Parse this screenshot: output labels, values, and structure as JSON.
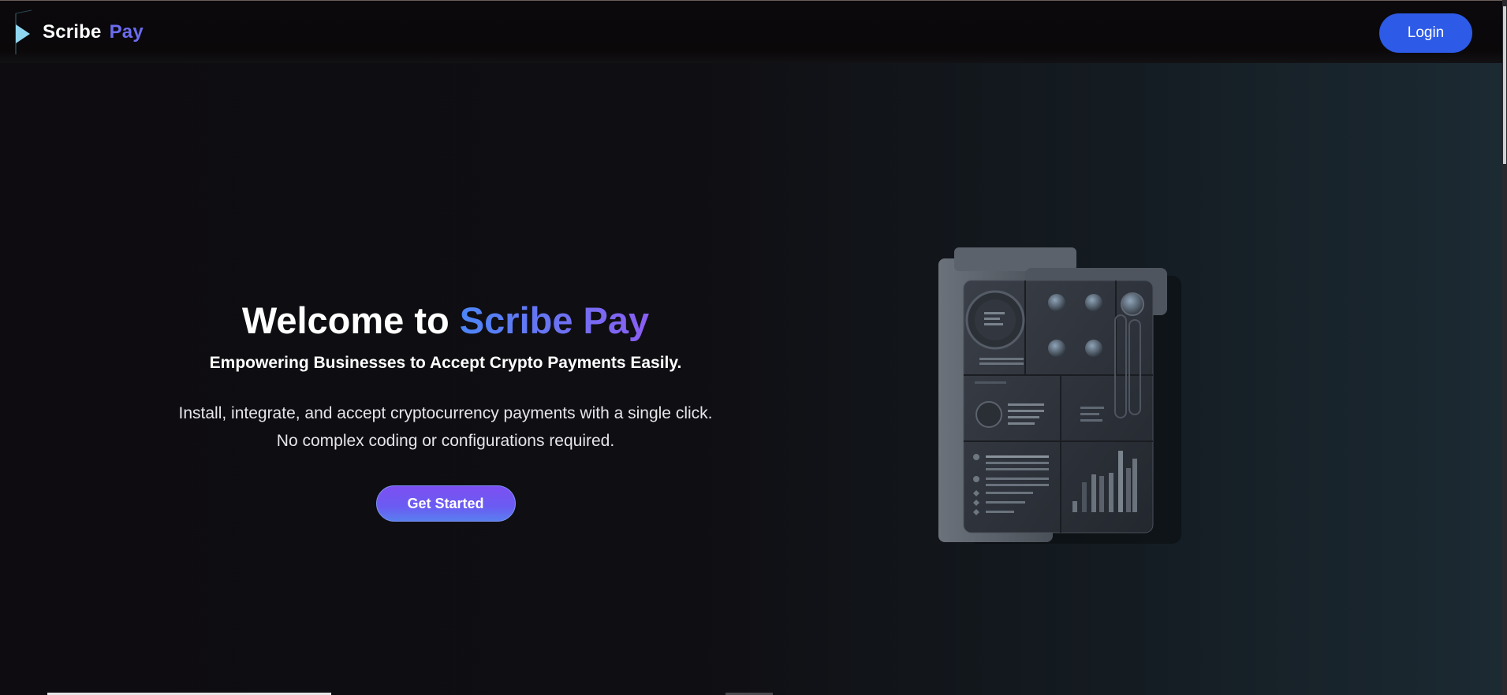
{
  "header": {
    "brand_word1": "Scribe",
    "brand_word2": "Pay",
    "login_label": "Login"
  },
  "hero": {
    "title_prefix": "Welcome to ",
    "title_highlight": "Scribe Pay",
    "subtitle": "Empowering Businesses to Accept Crypto Payments Easily.",
    "desc_line1": "Install, integrate, and accept cryptocurrency payments with a single click.",
    "desc_line2": "No complex coding or configurations required.",
    "cta_label": "Get Started"
  },
  "colors": {
    "accent_blue": "#2d5ae6",
    "brand_purple": "#6b6cf0",
    "gradient_start": "#4c86f7",
    "gradient_end": "#8a5ef3"
  },
  "icons": {
    "logo": "play-triangle-icon",
    "illustration": "payment-dashboard-device"
  }
}
